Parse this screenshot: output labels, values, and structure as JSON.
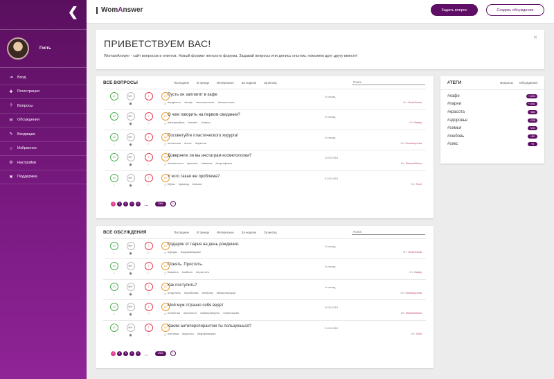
{
  "sidebar": {
    "back_icon": "chevron-left-icon",
    "user": {
      "name": "Гость"
    },
    "items": [
      {
        "label": "Вход",
        "icon": "login-icon",
        "glyph": "⇥"
      },
      {
        "label": "Регистрация",
        "icon": "user-plus-icon",
        "glyph": "✚"
      },
      {
        "label": "Вопросы",
        "icon": "question-icon",
        "glyph": "?"
      },
      {
        "label": "Обсуждения",
        "icon": "chat-icon",
        "glyph": "✉"
      },
      {
        "label": "Входящие",
        "icon": "inbox-icon",
        "glyph": "✎"
      },
      {
        "label": "Избранное",
        "icon": "star-icon",
        "glyph": "☆"
      },
      {
        "label": "Настройки",
        "icon": "gear-icon",
        "glyph": "⚙"
      },
      {
        "label": "Поддержка",
        "icon": "support-icon",
        "glyph": "✖"
      }
    ]
  },
  "header": {
    "logo_prefix": "Wom",
    "logo_accent": "A",
    "logo_suffix": "nswer",
    "ask_label": "Задать вопрос",
    "create_label": "Создать обсуждение"
  },
  "welcome": {
    "title": "ПРИВЕТСТВУЕМ ВАС!",
    "text": "WomanAnswer - сайт вопросов и ответов. Новый формат женского форума. Задавай вопросы или делись опытом, поможем друг другу вместе!",
    "close": "×"
  },
  "questions": {
    "title": "ВСЕ ВОПРОСЫ",
    "filters": [
      "Последние",
      "В тренде",
      "Интересные",
      "За неделю",
      "За месяц"
    ],
    "search_placeholder": "Поиск",
    "rows": [
      {
        "s1": "13",
        "s2": "99+",
        "s3": "7",
        "s4": "15",
        "title": "Пусть он заплатит в кафе",
        "tags": [
          "#видеость",
          "#кафе",
          "#ассьэкостант",
          "#немыслемо"
        ],
        "date": "3ч назад",
        "author_prefix": "От:",
        "author": "VivaVictoria"
      },
      {
        "s1": "13",
        "s2": "99+",
        "s3": "7",
        "s4": "15",
        "title": "О чем говорить на первом свидании?",
        "tags": [
          "#впервыйраз",
          "#этикет",
          "#парни"
        ],
        "date": "3ч назад",
        "author_prefix": "От:",
        "author": "Nataly"
      },
      {
        "s1": "13",
        "s2": "99+",
        "s3": "7",
        "s4": "15",
        "title": "Посоветуйте пластического хирурга!",
        "tags": [
          "#пластика",
          "#носс",
          "#красота"
        ],
        "date": "4ч назад",
        "author_prefix": "От:",
        "author": "Smolina-petra"
      },
      {
        "s1": "13",
        "s2": "99+",
        "s3": "7",
        "s4": "15",
        "title": "Доверяете ли вы инстаграм косметологам?",
        "tags": [
          "#косметолог",
          "#доклон",
          "#эвашка",
          "#сертификат"
        ],
        "date": "22.05.2018",
        "author_prefix": "От:",
        "author": "SimonaSitnos"
      },
      {
        "s1": "13",
        "s2": "99+",
        "s3": "7",
        "s4": "15",
        "title": "У кого такая же проблема?",
        "tags": [
          "#брак",
          "#развод",
          "#семья"
        ],
        "date": "01.05.2018",
        "author_prefix": "От:",
        "author": "Semi"
      }
    ],
    "pages": [
      "1",
      "2",
      "3",
      "4",
      "5"
    ],
    "dots": "...",
    "last_page": "2389",
    "next": "›"
  },
  "discussions": {
    "title": "ВСЕ ОБСУЖДЕНИЯ",
    "filters": [
      "Последние",
      "В тренде",
      "Интересные",
      "За неделю",
      "За месяц"
    ],
    "search_placeholder": "Поиск",
    "rows": [
      {
        "s1": "13",
        "s2": "99+",
        "s3": "7",
        "s4": "15",
        "title": "Подарок от парня на день рождения.",
        "tags": [
          "#урады",
          "#окружающими"
        ],
        "date": "3ч назад",
        "author_prefix": "От:",
        "author": "VivaVictoria"
      },
      {
        "s1": "13",
        "s2": "99+",
        "s3": "7",
        "s4": "15",
        "title": "Понять. Простить.",
        "tags": [
          "#измена",
          "#забыть",
          "#простить"
        ],
        "date": "3ч назад",
        "author_prefix": "От:",
        "author": "Nataly"
      },
      {
        "s1": "13",
        "s2": "99+",
        "s3": "7",
        "s4": "15",
        "title": "Как поступить?",
        "tags": [
          "#отделить",
          "#проблема",
          "#любовь",
          "#бывалюкаури"
        ],
        "date": "4ч назад",
        "author_prefix": "От:",
        "author": "Smolina-petra"
      },
      {
        "s1": "13",
        "s2": "99+",
        "s3": "7",
        "s4": "15",
        "title": "Мой муж странно себя ведет",
        "tags": [
          "#этикетка",
          "#апплесть",
          "#авепроверить",
          "#прбопъязю"
        ],
        "date": "22.05.2018",
        "author_prefix": "От:",
        "author": "SimonaSitnos"
      },
      {
        "s1": "13",
        "s2": "99+",
        "s3": "7",
        "s4": "15",
        "title": "Каким антиперспирантом ты пользуешься?",
        "tags": [
          "#личема",
          "#красота",
          "#парфюмерия"
        ],
        "date": "01.05.2018",
        "author_prefix": "От:",
        "author": "Semi"
      }
    ],
    "pages": [
      "1",
      "2",
      "3",
      "4",
      "5"
    ],
    "dots": "...",
    "last_page": "2389",
    "next": "›"
  },
  "tags_panel": {
    "title": "#ТЕГИ",
    "tabs": [
      "Вопросы",
      "Обсуждения"
    ],
    "tags": [
      {
        "name": "#кафе",
        "count": "+1200"
      },
      {
        "name": "#парни",
        "count": "+1052"
      },
      {
        "name": "#красота",
        "count": "+882"
      },
      {
        "name": "#здоровье",
        "count": "+326"
      },
      {
        "name": "#семья",
        "count": "+231"
      },
      {
        "name": "#любовь",
        "count": "+80"
      },
      {
        "name": "#секс",
        "count": "+8"
      }
    ]
  },
  "colors": {
    "brand": "#5e0e64",
    "accent_pink": "#e0408a",
    "author": "#c0445e"
  }
}
